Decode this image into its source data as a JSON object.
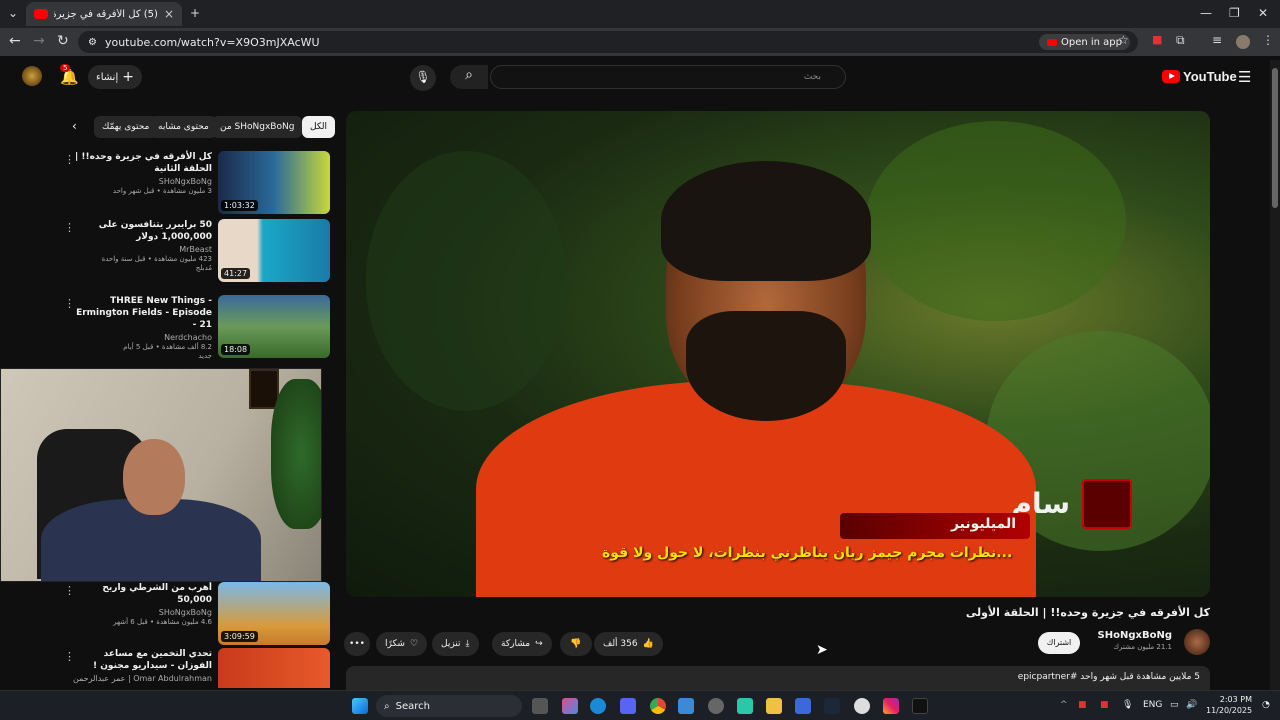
{
  "browser": {
    "tab_title": "(5) كل الأفرقه في جزيرة وحدة",
    "url": "youtube.com/watch?v=X9O3mJXAcWU",
    "open_in_app": "Open in app"
  },
  "yt_header": {
    "logo": "YouTube",
    "create_label": "إنشاء",
    "notif_count": "5",
    "search_placeholder": "بحث"
  },
  "chips": [
    "الكل",
    "من SHoNgxBoNg",
    "محتوى مشابه",
    "محتوى يهمّك"
  ],
  "recommendations": [
    {
      "title": "كل الأفرقه في جزيرة وحده!! | الحلقة الثانية",
      "channel": "SHoNgxBoNg",
      "views": "3 مليون مشاهدة • قبل شهر واحد",
      "duration": "1:03:32",
      "thumb_color": "#2a6a9a"
    },
    {
      "title": "50 برايبرر يتنافسون على 1,000,000 دولار",
      "channel": "MrBeast",
      "views": "423 مليون مشاهدة • قبل سنة واحدة",
      "badge": "مُدبلج",
      "duration": "41:27",
      "thumb_color": "#1aa8c8"
    },
    {
      "title": "THREE New Things - Ermington Fields - Episode 21 -",
      "channel": "Nerdchacho",
      "views": "8.2 ألف مشاهدة • قبل 5 أيام",
      "badge": "جديد",
      "duration": "18:08",
      "thumb_color": "#5a8a3a"
    },
    {
      "title": "أهرب من الشرطي واربح 50,000",
      "channel": "SHoNgxBoNg",
      "views": "4.6 مليون مشاهدة • قبل 6 أشهر",
      "duration": "3:09:59",
      "thumb_color": "#d89a3a"
    },
    {
      "title": "تحدي التخمين مع مساعد الفوزان - سيداريو مجنون !",
      "channel": "Omar Abdulrahman | عمر عبدالرحمن",
      "views": "",
      "duration": "",
      "thumb_color": "#c83a1a"
    }
  ],
  "video": {
    "title": "كل الأفرقه في جزيرة وحده!! | الحلقة الأولى",
    "name_overlay": "سام",
    "tag_overlay": "الميليونير",
    "subtitle": "...نظرات مجرم جيمز ريان يناظرني بنظرات، لا حول ولا قوة",
    "channel_name": "SHoNgxBoNg",
    "subscribers": "21.1 مليون مشترك",
    "subscribe": "اشتراك",
    "likes": "356 ألف",
    "share": "مشاركة",
    "download": "تنزيل",
    "thanks": "شكرًا",
    "desc": "5 ملايين مشاهدة  قبل شهر واحد  #epicpartner"
  },
  "taskbar": {
    "search": "Search",
    "lang": "ENG",
    "time": "2:03 PM",
    "date": "11/20/2025"
  }
}
